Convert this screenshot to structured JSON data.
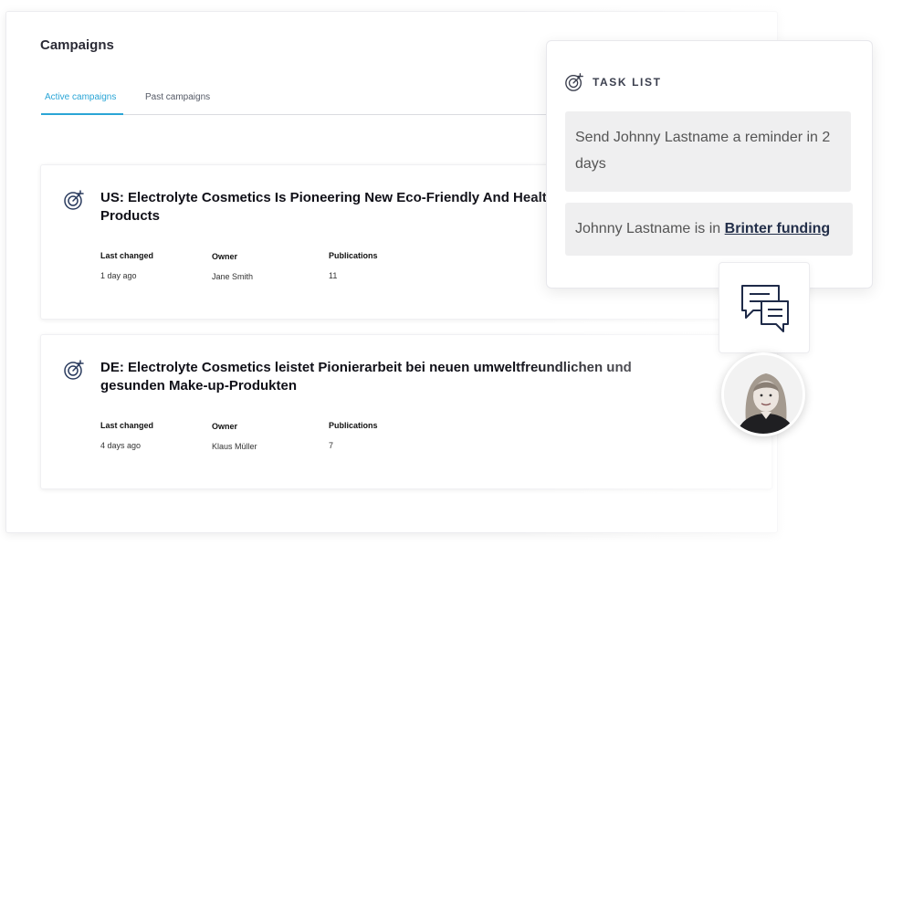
{
  "page": {
    "title": "Campaigns"
  },
  "tabs": [
    {
      "label": "Active campaigns",
      "active": true
    },
    {
      "label": "Past campaigns",
      "active": false
    }
  ],
  "campaigns": [
    {
      "title": "US: Electrolyte Cosmetics Is Pioneering New Eco-Friendly And Healthy Make-Up Products",
      "last_changed_label": "Last changed",
      "last_changed": "1 day ago",
      "owner_label": "Owner",
      "owner": "Jane Smith",
      "publications_label": "Publications",
      "publications": "11"
    },
    {
      "title": "DE: Electrolyte Cosmetics leistet Pionierarbeit bei neuen umweltfreundlichen und gesunden Make-up-Produkten",
      "last_changed_label": "Last changed",
      "last_changed": "4 days ago",
      "owner_label": "Owner",
      "owner": "Klaus Müller",
      "publications_label": "Publications",
      "publications": "7"
    }
  ],
  "task_list": {
    "header": "TASK LIST",
    "items": [
      {
        "text": "Send Johnny Lastname a reminder in 2 days"
      },
      {
        "prefix": "Johnny Lastname is in ",
        "link": "Brinter funding"
      }
    ]
  },
  "icons": {
    "campaign": "target-icon",
    "task_list": "target-icon",
    "chat": "chat-bubbles-icon",
    "avatar": "user-avatar"
  },
  "colors": {
    "accent": "#2aa5d6",
    "link": "#232f4a",
    "task_item_bg": "#efeff0",
    "icon": "#2a3b5e"
  }
}
